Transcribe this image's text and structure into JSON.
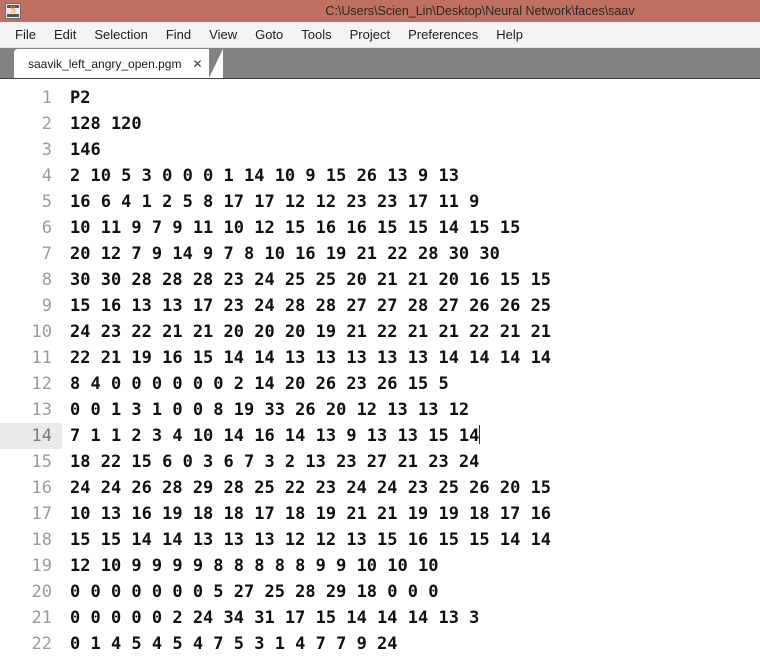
{
  "window": {
    "title": "C:\\Users\\Scien_Lin\\Desktop\\Neural Network\\faces\\saav",
    "app_icon": "sublime-text-icon",
    "app_icon_glyph": "S",
    "titlebar_color": "#bf7060"
  },
  "menubar": {
    "items": [
      {
        "label": "File"
      },
      {
        "label": "Edit"
      },
      {
        "label": "Selection"
      },
      {
        "label": "Find"
      },
      {
        "label": "View"
      },
      {
        "label": "Goto"
      },
      {
        "label": "Tools"
      },
      {
        "label": "Project"
      },
      {
        "label": "Preferences"
      },
      {
        "label": "Help"
      }
    ]
  },
  "tabbar": {
    "tabs": [
      {
        "label": "saavik_left_angry_open.pgm",
        "close_glyph": "✕",
        "active": true
      }
    ]
  },
  "editor": {
    "active_line": 14,
    "cursor_line": 14,
    "lines": [
      {
        "number": "1",
        "text": "P2"
      },
      {
        "number": "2",
        "text": "128 120"
      },
      {
        "number": "3",
        "text": "146"
      },
      {
        "number": "4",
        "text": "2 10 5 3 0 0 0 1 14 10 9 15 26 13 9 13"
      },
      {
        "number": "5",
        "text": "16 6 4 1 2 5 8 17 17 12 12 23 23 17 11 9"
      },
      {
        "number": "6",
        "text": "10 11 9 7 9 11 10 12 15 16 16 15 15 14 15 15"
      },
      {
        "number": "7",
        "text": "20 12 7 9 14 9 7 8 10 16 19 21 22 28 30 30"
      },
      {
        "number": "8",
        "text": "30 30 28 28 28 23 24 25 25 20 21 21 20 16 15 15"
      },
      {
        "number": "9",
        "text": "15 16 13 13 17 23 24 28 28 27 27 28 27 26 26 25"
      },
      {
        "number": "10",
        "text": "24 23 22 21 21 20 20 20 19 21 22 21 21 22 21 21"
      },
      {
        "number": "11",
        "text": "22 21 19 16 15 14 14 13 13 13 13 13 14 14 14 14"
      },
      {
        "number": "12",
        "text": "8 4 0 0 0 0 0 0 2 14 20 26 23 26 15 5"
      },
      {
        "number": "13",
        "text": "0 0 1 3 1 0 0 8 19 33 26 20 12 13 13 12"
      },
      {
        "number": "14",
        "text": "7 1 1 2 3 4 10 14 16 14 13 9 13 13 15 14"
      },
      {
        "number": "15",
        "text": "18 22 15 6 0 3 6 7 3 2 13 23 27 21 23 24"
      },
      {
        "number": "16",
        "text": "24 24 26 28 29 28 25 22 23 24 24 23 25 26 20 15"
      },
      {
        "number": "17",
        "text": "10 13 16 19 18 18 17 18 19 21 21 19 19 18 17 16"
      },
      {
        "number": "18",
        "text": "15 15 14 14 13 13 13 12 12 13 15 16 15 15 14 14"
      },
      {
        "number": "19",
        "text": "12 10 9 9 9 9 8 8 8 8 8 9 9 10 10 10"
      },
      {
        "number": "20",
        "text": "0 0 0 0 0 0 0 5 27 25 28 29 18 0 0 0"
      },
      {
        "number": "21",
        "text": "0 0 0 0 0 2 24 34 31 17 15 14 14 14 13 3"
      },
      {
        "number": "22",
        "text": "0 1 4 5 4 5 4 7 5 3 1 4 7 7 9 24"
      }
    ]
  }
}
